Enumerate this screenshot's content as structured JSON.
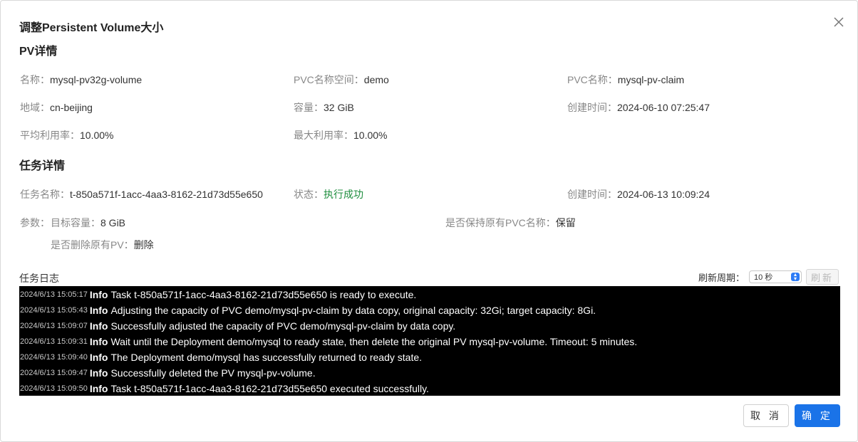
{
  "dialog": {
    "title": "调整Persistent Volume大小",
    "cancel_label": "取 消",
    "ok_label": "确 定"
  },
  "pv": {
    "section_title": "PV详情",
    "name_label": "名称：",
    "name": "mysql-pv32g-volume",
    "pvc_ns_label": "PVC名称空间：",
    "pvc_ns": "demo",
    "pvc_name_label": "PVC名称：",
    "pvc_name": "mysql-pv-claim",
    "region_label": "地域：",
    "region": "cn-beijing",
    "capacity_label": "容量：",
    "capacity": "32 GiB",
    "created_label": "创建时间：",
    "created": "2024-06-10 07:25:47",
    "avg_util_label": "平均利用率：",
    "avg_util": "10.00%",
    "max_util_label": "最大利用率：",
    "max_util": "10.00%"
  },
  "task": {
    "section_title": "任务详情",
    "name_label": "任务名称：",
    "name": "t-850a571f-1acc-4aa3-8162-21d73d55e650",
    "status_label": "状态：",
    "status": "执行成功",
    "created_label": "创建时间：",
    "created": "2024-06-13 10:09:24",
    "params_label": "参数：",
    "target_cap_label": "目标容量：",
    "target_cap": "8 GiB",
    "keep_pvc_label": "是否保持原有PVC名称：",
    "keep_pvc": "保留",
    "delete_pv_label": "是否删除原有PV：",
    "delete_pv": "删除"
  },
  "log": {
    "title": "任务日志",
    "refresh_label": "刷新周期：",
    "refresh_value": "10 秒",
    "refresh_button": "刷新",
    "lines": [
      {
        "ts": "2024/6/13 15:05:17",
        "level": "Info",
        "msg": "Task t-850a571f-1acc-4aa3-8162-21d73d55e650 is ready to execute."
      },
      {
        "ts": "2024/6/13 15:05:43",
        "level": "Info",
        "msg": "Adjusting the capacity of PVC demo/mysql-pv-claim by data copy, original capacity: 32Gi; target capacity: 8Gi."
      },
      {
        "ts": "2024/6/13 15:09:07",
        "level": "Info",
        "msg": "Successfully adjusted the capacity of PVC demo/mysql-pv-claim by data copy."
      },
      {
        "ts": "2024/6/13 15:09:31",
        "level": "Info",
        "msg": "Wait until the Deployment demo/mysql to ready state, then delete the original PV mysql-pv-volume. Timeout: 5 minutes."
      },
      {
        "ts": "2024/6/13 15:09:40",
        "level": "Info",
        "msg": "The Deployment demo/mysql has successfully returned to ready state."
      },
      {
        "ts": "2024/6/13 15:09:47",
        "level": "Info",
        "msg": "Successfully deleted the PV mysql-pv-volume."
      },
      {
        "ts": "2024/6/13 15:09:50",
        "level": "Info",
        "msg": "Task t-850a571f-1acc-4aa3-8162-21d73d55e650 executed successfully."
      }
    ]
  },
  "colors": {
    "primary": "#1a73e8",
    "success": "#1e8e3e",
    "log_bg": "#000000"
  }
}
